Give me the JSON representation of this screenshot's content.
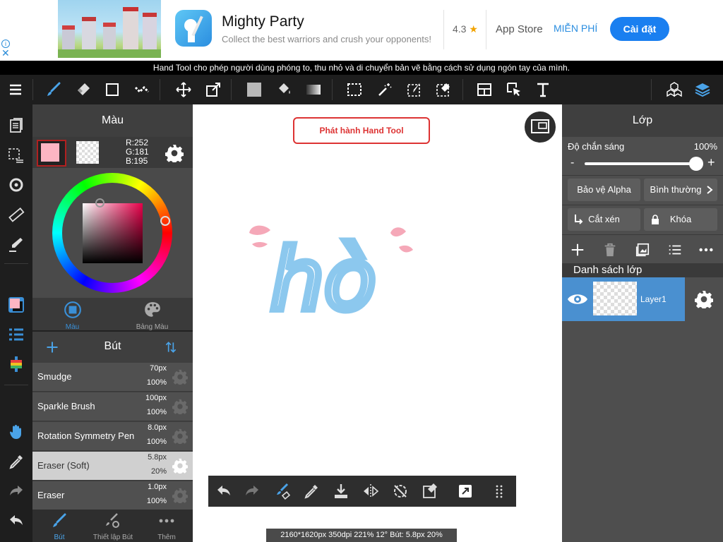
{
  "ad": {
    "title": "Mighty Party",
    "subtitle": "Collect the best warriors and crush your opponents!",
    "rating": "4.3",
    "store": "App Store",
    "price": "MIỄN PHÍ",
    "install": "Cài đặt",
    "info_glyph": "i",
    "close_glyph": "✕"
  },
  "tooltip": "Hand Tool cho phép người dùng phóng to, thu nhỏ và di chuyển bản vẽ bằng cách sử dụng ngón tay của mình.",
  "color_panel": {
    "title": "Màu",
    "primary_color": "#fcb5c3",
    "r": "R:252",
    "g": "G:181",
    "b": "B:195",
    "tabs": [
      {
        "label": "Màu",
        "active": true
      },
      {
        "label": "Bảng Màu",
        "active": false
      }
    ]
  },
  "brush_panel": {
    "title": "Bút",
    "brushes": [
      {
        "name": "Smudge",
        "size": "70px",
        "opacity": "100%",
        "selected": false
      },
      {
        "name": "Sparkle Brush",
        "size": "100px",
        "opacity": "100%",
        "selected": false
      },
      {
        "name": "Rotation Symmetry Pen",
        "size": "8.0px",
        "opacity": "100%",
        "selected": false
      },
      {
        "name": "Eraser (Soft)",
        "size": "5.8px",
        "opacity": "20%",
        "selected": true
      },
      {
        "name": "Eraser",
        "size": "1.0px",
        "opacity": "100%",
        "selected": false
      }
    ],
    "tabs": [
      {
        "label": "Bút",
        "active": true
      },
      {
        "label": "Thiết lập Bút",
        "active": false
      },
      {
        "label": "Thêm",
        "active": false
      }
    ]
  },
  "canvas": {
    "release_button": "Phát hành Hand Tool",
    "drawing_text": "hò",
    "status": "2160*1620px 350dpi 221% 12° Bút: 5.8px 20%"
  },
  "layer_panel": {
    "title": "Lớp",
    "opacity_label": "Độ chắn sáng",
    "opacity_value": "100%",
    "opacity_fraction": 1.0,
    "minus": "-",
    "plus": "+",
    "alpha_protect": "Bảo vệ Alpha",
    "blend_mode": "Bình thường",
    "clipping": "Cắt xén",
    "lock": "Khóa",
    "list_title": "Danh sách lớp",
    "layers": [
      {
        "name": "Layer1",
        "visible": true,
        "selected": true
      }
    ]
  },
  "colors": {
    "accent": "#3a8fd6",
    "brush_stroke": "#8cc8ee",
    "pink": "#f5a8b8",
    "toolbar_bg": "#1e1e1e",
    "panel_bg": "#4a4a4a"
  }
}
